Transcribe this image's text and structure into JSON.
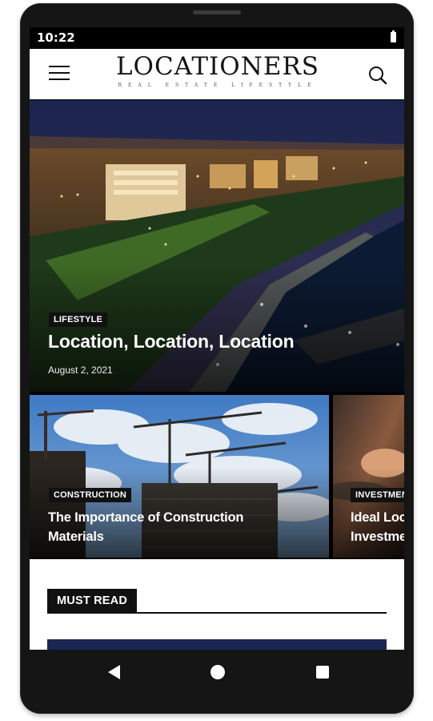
{
  "status_bar": {
    "time": "10:22"
  },
  "app_bar": {
    "logo_title": "LOCATIONERS",
    "logo_subtitle": "REAL ESTATE LIFESTYLE",
    "menu_icon": "hamburger-menu-icon",
    "search_icon": "search-icon"
  },
  "hero": {
    "category": "LIFESTYLE",
    "title": "Location, Location, Location",
    "date": "August 2, 2021"
  },
  "cards": [
    {
      "category": "CONSTRUCTION",
      "title_line1": "The Importance of Construction",
      "title_line2": "Materials"
    },
    {
      "category": "INVESTMENT",
      "title_line1": "Ideal Locations for",
      "title_line2": "Investment"
    }
  ],
  "sections": {
    "must_read_label": "MUST READ"
  },
  "nav_bar": {
    "back_icon": "back-triangle-icon",
    "home_icon": "home-circle-icon",
    "recent_icon": "recent-apps-square-icon"
  },
  "colors": {
    "accent_dark": "#111111",
    "must_read_bar": "#1b2654",
    "night_sea": "#0c1b33"
  }
}
